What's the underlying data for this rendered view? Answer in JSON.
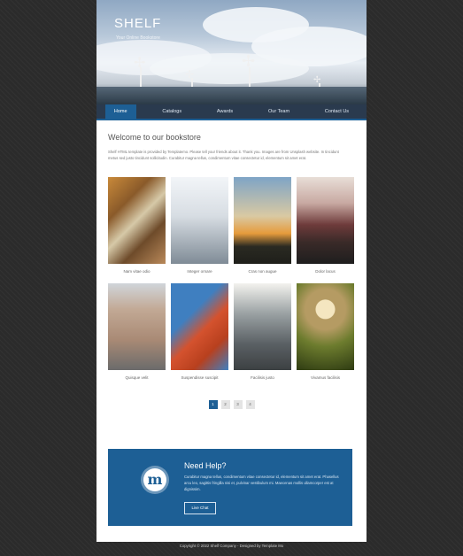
{
  "header": {
    "brand": "SHELF",
    "tagline": "Your Online Bookstore"
  },
  "nav": {
    "items": [
      "Home",
      "Catalogs",
      "Awards",
      "Our Team",
      "Contact Us"
    ],
    "active": "Home"
  },
  "welcome": {
    "title": "Welcome to our bookstore",
    "text": "Shelf HTML template is provided by Templatemo. Please tell your friends about it. Thank you. Images are from Unsplash website. In tincidunt metus sed justo tincidunt sollicitudin. Curabitur magna tellus, condimentum vitae consectetur id, elementum sit amet erat."
  },
  "books": [
    {
      "title": "Nam vitae odio",
      "image": "autumn-forest"
    },
    {
      "title": "Integer ornare",
      "image": "skyscraper"
    },
    {
      "title": "Cras non augue",
      "image": "jumping-person"
    },
    {
      "title": "Dolor lacus",
      "image": "mountain-road"
    },
    {
      "title": "Quisque velit",
      "image": "house-car"
    },
    {
      "title": "Suspendisse suscipit",
      "image": "red-bridge"
    },
    {
      "title": "Facilisis justo",
      "image": "stairs"
    },
    {
      "title": "Vivamus facilisis",
      "image": "mushroom"
    }
  ],
  "pagination": {
    "pages": [
      "1",
      "2",
      "3",
      "4"
    ],
    "current": "1"
  },
  "help": {
    "title": "Need Help?",
    "text": "Curabitur magna tellus, condimentum vitae consectetur id, elementum sit amet erat. Phasellus arcu leo, sagittis fringilla nisi et, pulvinar vestibulum mi. Maecenas mollis ullamcorper est at dignissim.",
    "button": "Live Chat",
    "logo_letter": "m"
  },
  "footer": {
    "text": "Copyright © 2022 Shelf Company - Designed by Template Mo"
  },
  "colors": {
    "accent": "#1d5f95",
    "nav_bg": "#2a3a4e",
    "page_bg": "#2b2b2b"
  }
}
